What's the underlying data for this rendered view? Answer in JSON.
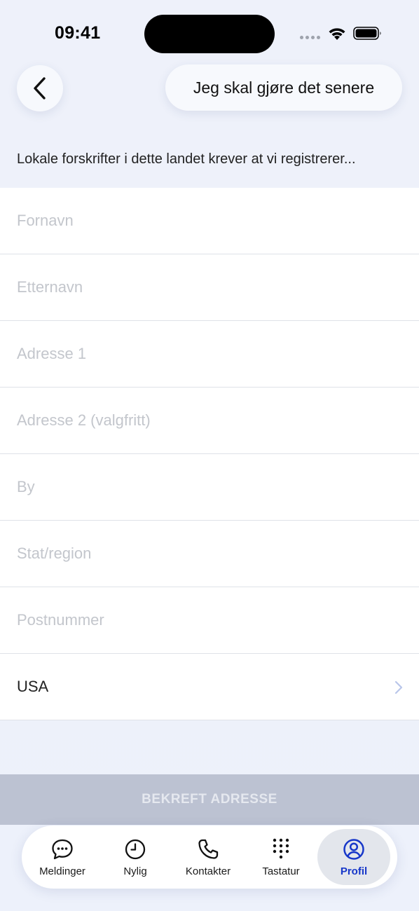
{
  "status_bar": {
    "time": "09:41"
  },
  "header": {
    "later_label": "Jeg skal gjøre det senere"
  },
  "description": "Lokale forskrifter i dette landet krever at vi registrerer...",
  "form": {
    "first_name_placeholder": "Fornavn",
    "last_name_placeholder": "Etternavn",
    "address1_placeholder": "Adresse 1",
    "address2_placeholder": "Adresse 2 (valgfritt)",
    "city_placeholder": "By",
    "state_placeholder": "Stat/region",
    "zip_placeholder": "Postnummer",
    "country_value": "USA"
  },
  "confirm_label": "BEKREFT ADRESSE",
  "tabs": [
    {
      "label": "Meldinger",
      "icon": "chat-bubble-icon"
    },
    {
      "label": "Nylig",
      "icon": "clock-icon"
    },
    {
      "label": "Kontakter",
      "icon": "phone-icon"
    },
    {
      "label": "Tastatur",
      "icon": "keypad-icon"
    },
    {
      "label": "Profil",
      "icon": "profile-icon",
      "active": true
    }
  ],
  "colors": {
    "accent": "#1737c9",
    "confirm_disabled_bg": "#bcc2d2",
    "background": "#edf1fa"
  }
}
